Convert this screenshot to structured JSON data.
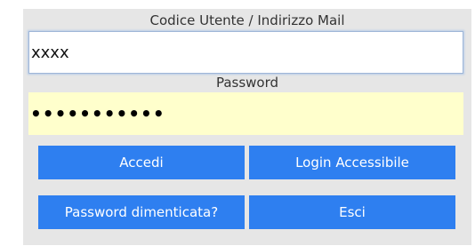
{
  "login": {
    "user_label": "Codice Utente / Indirizzo Mail",
    "user_value": "xxxx",
    "password_label": "Password",
    "password_masked": "•••••••••••",
    "buttons": {
      "accedi": "Accedi",
      "login_accessibile": "Login Accessibile",
      "password_dimenticata": "Password dimenticata?",
      "esci": "Esci"
    }
  },
  "colors": {
    "panel_background": "#e6e6e6",
    "password_field_background": "#ffffcc",
    "button_background": "#2e7ff0",
    "button_text": "#ffffff"
  }
}
